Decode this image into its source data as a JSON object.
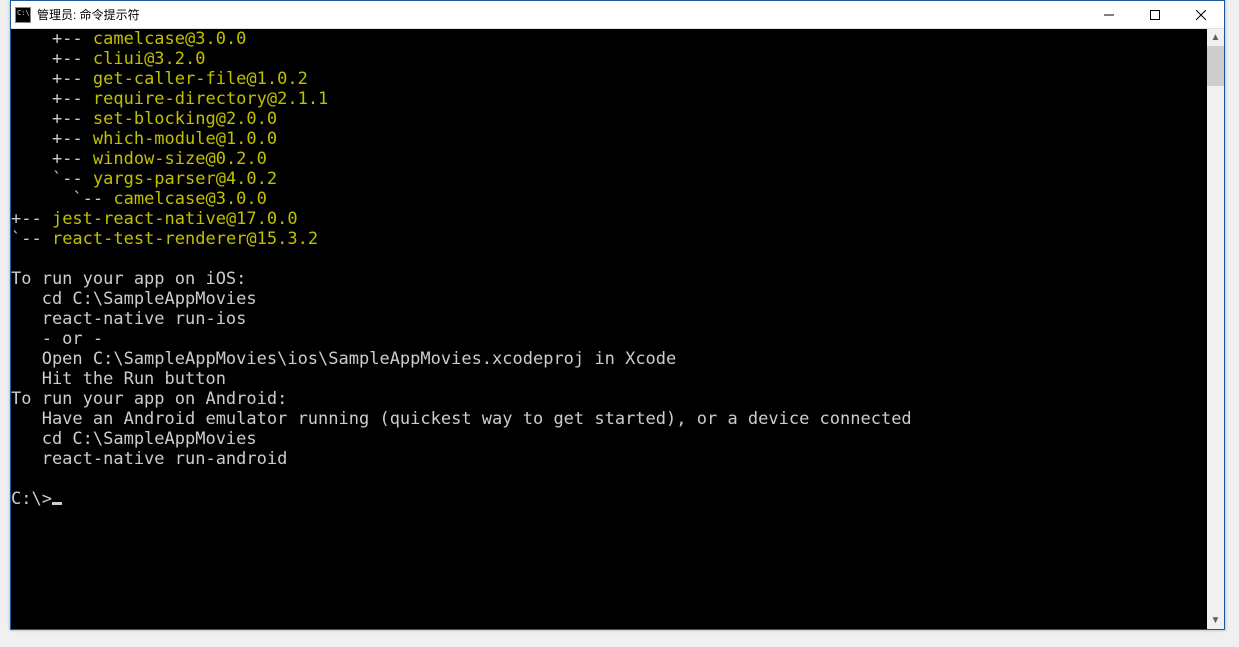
{
  "window": {
    "title": "管理员: 命令提示符"
  },
  "tree_lines": [
    {
      "prefix": "    +-- ",
      "text": "camelcase@3.0.0"
    },
    {
      "prefix": "    +-- ",
      "text": "cliui@3.2.0"
    },
    {
      "prefix": "    +-- ",
      "text": "get-caller-file@1.0.2"
    },
    {
      "prefix": "    +-- ",
      "text": "require-directory@2.1.1"
    },
    {
      "prefix": "    +-- ",
      "text": "set-blocking@2.0.0"
    },
    {
      "prefix": "    +-- ",
      "text": "which-module@1.0.0"
    },
    {
      "prefix": "    +-- ",
      "text": "window-size@0.2.0"
    },
    {
      "prefix": "    `-- ",
      "text": "yargs-parser@4.0.2"
    },
    {
      "prefix": "      `-- ",
      "text": "camelcase@3.0.0"
    },
    {
      "prefix": "+-- ",
      "text": "jest-react-native@17.0.0"
    },
    {
      "prefix": "`-- ",
      "text": "react-test-renderer@15.3.2"
    }
  ],
  "instructions": [
    "",
    "To run your app on iOS:",
    "   cd C:\\SampleAppMovies",
    "   react-native run-ios",
    "   - or -",
    "   Open C:\\SampleAppMovies\\ios\\SampleAppMovies.xcodeproj in Xcode",
    "   Hit the Run button",
    "To run your app on Android:",
    "   Have an Android emulator running (quickest way to get started), or a device connected",
    "   cd C:\\SampleAppMovies",
    "   react-native run-android",
    ""
  ],
  "prompt": "C:\\>"
}
